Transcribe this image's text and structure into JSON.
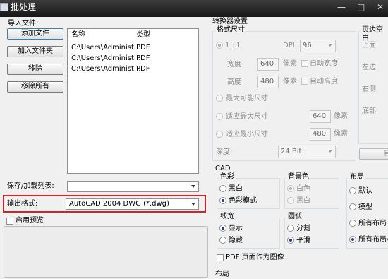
{
  "window": {
    "title": "批处理",
    "ghost_text": "",
    "controls": [
      "—",
      "□",
      "✕"
    ]
  },
  "import": {
    "label": "导入文件:",
    "buttons": {
      "add_file": "添加文件",
      "add_folder": "加入文件夹",
      "remove": "移除",
      "remove_all": "移除所有"
    },
    "columns": [
      "名称",
      "类型"
    ],
    "rows": [
      {
        "name": "C:\\Users\\Administ...",
        "type": "PDF"
      },
      {
        "name": "C:\\Users\\Administ...",
        "type": "PDF"
      },
      {
        "name": "C:\\Users\\Administ...",
        "type": "PDF"
      }
    ]
  },
  "save_list": {
    "label": "保存/加载列表:",
    "value": ""
  },
  "output_format": {
    "label": "输出格式:",
    "value": "AutoCAD 2004 DWG (*.dwg)"
  },
  "preview": {
    "label": "启用预览",
    "checked": false
  },
  "converter": {
    "title": "转换器设置",
    "format_size": {
      "title": "格式尺寸",
      "ratio": "1 : 1",
      "dpi_label": "DPI:",
      "dpi_value": "96",
      "width_label": "宽度",
      "width_value": "640",
      "height_label": "高度",
      "height_value": "480",
      "unit": "像素",
      "auto_width": "自动宽度",
      "auto_height": "自动高度",
      "max_possible": "最大可能尺寸",
      "fit_max": "适应最大尺寸",
      "fit_max_value": "640",
      "fit_min": "适应最小尺寸",
      "fit_min_value": "480",
      "depth_label": "深度:",
      "depth_value": "24 Bit"
    },
    "margins": {
      "title": "页边空白",
      "top": "上面",
      "left": "左边",
      "right": "右侧",
      "bottom": "底部",
      "button_partial": "自"
    }
  },
  "cad": {
    "title": "CAD",
    "color": {
      "title": "色彩",
      "options": [
        "黑白",
        "色彩模式"
      ],
      "selected": 1
    },
    "background": {
      "title": "背景色",
      "options": [
        "白色",
        "黑白"
      ],
      "selected": 0
    },
    "layout": {
      "title": "布局",
      "options": [
        "默认",
        "模型",
        "所有布局",
        "所有布局与"
      ],
      "selected": 3
    },
    "linewidth": {
      "title": "线宽",
      "options": [
        "显示",
        "隐藏"
      ],
      "selected": 0
    },
    "arc": {
      "title": "圆弧",
      "options": [
        "分割",
        "平滑"
      ],
      "selected": 1
    },
    "pdf_as_image": {
      "label": "PDF 页面作为图像",
      "checked": false
    }
  },
  "bottom_label": "布局",
  "colors": {
    "highlight": "#e02020",
    "radio_dot": "#1c3d86",
    "titlebar": "#161616"
  }
}
